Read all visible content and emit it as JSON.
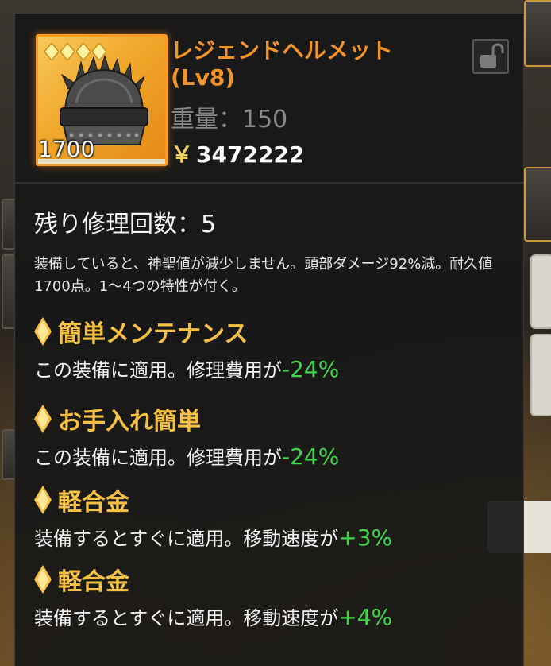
{
  "item": {
    "name": "レジェンドヘルメット(Lv8)",
    "weight_label": "重量：150",
    "price_symbol": "￥",
    "price": "3472222",
    "durability": "1700",
    "rarity_stars": 4,
    "icon": "helmet-icon"
  },
  "lock": {
    "icon": "padlock-open-icon"
  },
  "repair": {
    "label": "残り修理回数：5"
  },
  "description": "装備していると、神聖値が減少しません。頭部ダメージ92%減。耐久値1700点。1〜4つの特性が付く。",
  "traits": [
    {
      "name": "簡単メンテナンス",
      "text": "この装備に適用。修理費用が",
      "value": "-24%"
    },
    {
      "name": "お手入れ簡単",
      "text": "この装備に適用。修理費用が",
      "value": "-24%"
    },
    {
      "name": "軽合金",
      "text": "装備するとすぐに適用。移動速度が",
      "value": "+3%"
    },
    {
      "name": "軽合金",
      "text": "装備するとすぐに適用。移動速度が",
      "value": "+4%"
    }
  ],
  "colors": {
    "item_name": "#f2932a",
    "trait_title": "#f6c143",
    "positive_value": "#3fd64a",
    "rarity_border": "#ff9a1e"
  }
}
